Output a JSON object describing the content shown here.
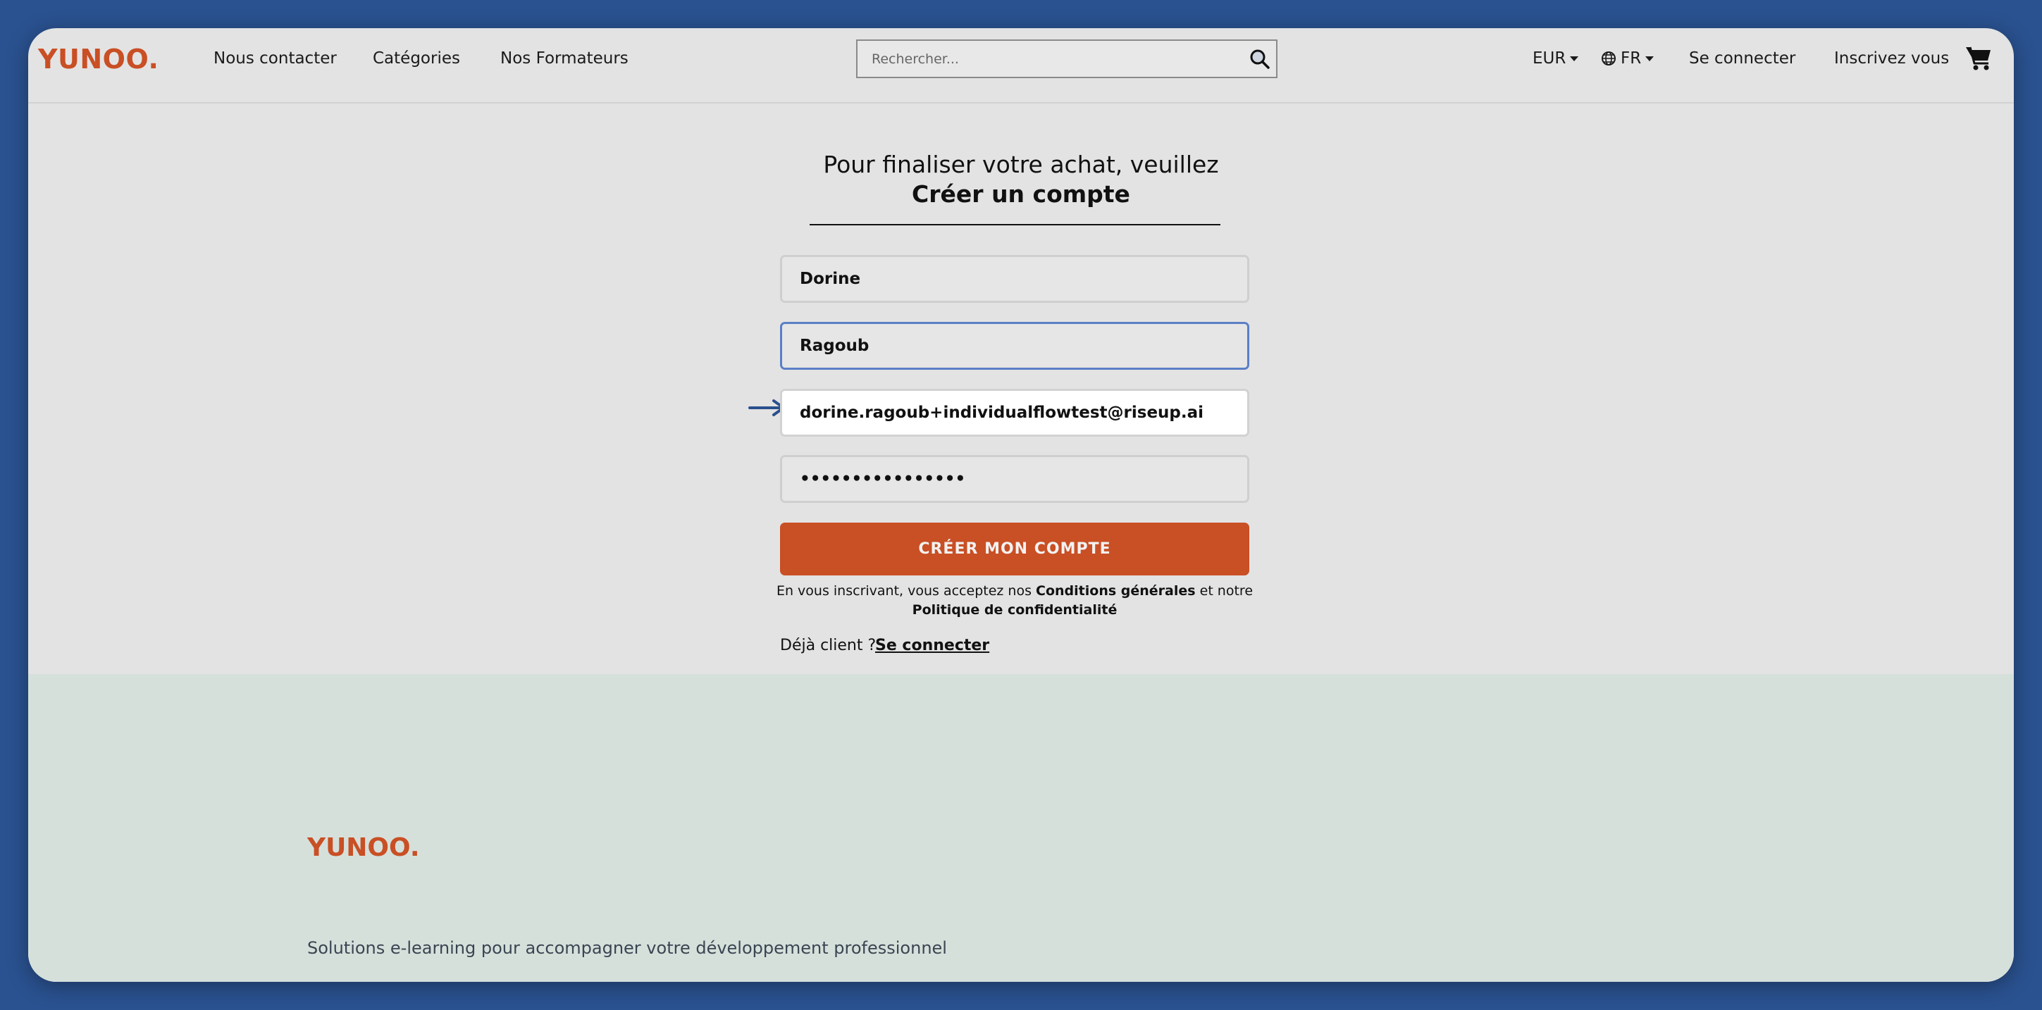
{
  "header": {
    "logo": "YUNOO.",
    "nav": [
      "Nous contacter",
      "Catégories",
      "Nos Formateurs"
    ],
    "search_placeholder": "Rechercher...",
    "currency": "EUR",
    "language": "FR",
    "login": "Se connecter",
    "signup": "Inscrivez vous"
  },
  "form": {
    "title_line1": "Pour finaliser votre achat, veuillez",
    "title_line2": "Créer un compte",
    "first_name": "Dorine",
    "last_name": "Ragoub",
    "email": "dorine.ragoub+individualflowtest@riseup.ai",
    "password": "••••••••••••••••",
    "submit": "CRÉER MON COMPTE",
    "terms_prefix": "En vous inscrivant, vous acceptez nos",
    "terms_link": "Conditions générales",
    "terms_middle": "et notre",
    "privacy_link": "Politique de confidentialité",
    "already_client": "Déjà client ?",
    "login_link": "Se connecter"
  },
  "footer": {
    "logo": "YUNOO.",
    "tagline": "Solutions e-learning pour accompagner votre développement professionnel"
  },
  "colors": {
    "brand": "#c94f24",
    "page_bg": "#2a5290",
    "footer_bg": "#d6e0db"
  }
}
